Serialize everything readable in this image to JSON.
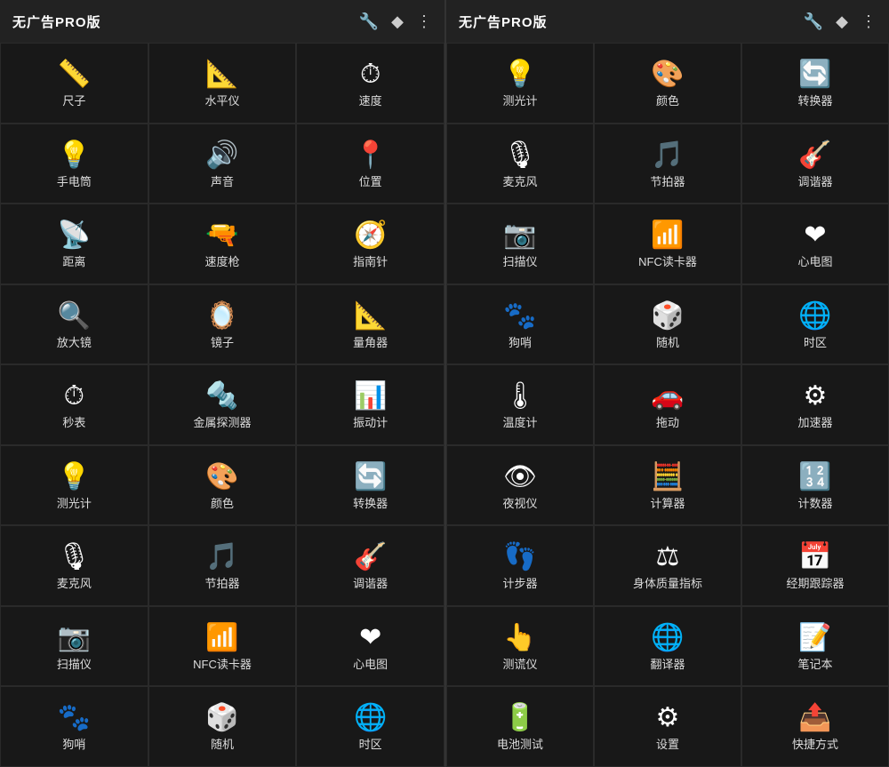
{
  "panels": [
    {
      "id": "left",
      "title": "无广告PRO版",
      "icons": {
        "wrench": "🔧",
        "diamond": "♦",
        "more": "⋮"
      },
      "cells": [
        {
          "icon": "📏",
          "label": "尺子"
        },
        {
          "icon": "📐",
          "label": "水平仪"
        },
        {
          "icon": "⏱",
          "label": "速度"
        },
        {
          "icon": "💡",
          "label": "手电筒"
        },
        {
          "icon": "🔊",
          "label": "声音"
        },
        {
          "icon": "📍",
          "label": "位置"
        },
        {
          "icon": "📡",
          "label": "距离"
        },
        {
          "icon": "🔫",
          "label": "速度枪"
        },
        {
          "icon": "🧭",
          "label": "指南针"
        },
        {
          "icon": "🔍",
          "label": "放大镜"
        },
        {
          "icon": "🪞",
          "label": "镜子"
        },
        {
          "icon": "📐",
          "label": "量角器"
        },
        {
          "icon": "⏱",
          "label": "秒表"
        },
        {
          "icon": "🔩",
          "label": "金属探测器"
        },
        {
          "icon": "📊",
          "label": "振动计"
        },
        {
          "icon": "💡",
          "label": "测光计"
        },
        {
          "icon": "🎨",
          "label": "颜色"
        },
        {
          "icon": "🔄",
          "label": "转换器"
        },
        {
          "icon": "🎙",
          "label": "麦克风"
        },
        {
          "icon": "🎵",
          "label": "节拍器"
        },
        {
          "icon": "🎸",
          "label": "调谐器"
        },
        {
          "icon": "📷",
          "label": "扫描仪"
        },
        {
          "icon": "📶",
          "label": "NFC读卡器"
        },
        {
          "icon": "❤",
          "label": "心电图"
        },
        {
          "icon": "🐾",
          "label": "狗哨"
        },
        {
          "icon": "🎲",
          "label": "随机"
        },
        {
          "icon": "🌐",
          "label": "时区"
        }
      ]
    },
    {
      "id": "right",
      "title": "无广告PRO版",
      "icons": {
        "wrench": "🔧",
        "diamond": "♦",
        "more": "⋮"
      },
      "cells": [
        {
          "icon": "💡",
          "label": "测光计"
        },
        {
          "icon": "🎨",
          "label": "颜色"
        },
        {
          "icon": "🔄",
          "label": "转换器"
        },
        {
          "icon": "🎙",
          "label": "麦克风"
        },
        {
          "icon": "🎵",
          "label": "节拍器"
        },
        {
          "icon": "🎸",
          "label": "调谐器"
        },
        {
          "icon": "📷",
          "label": "扫描仪"
        },
        {
          "icon": "📶",
          "label": "NFC读卡器"
        },
        {
          "icon": "❤",
          "label": "心电图"
        },
        {
          "icon": "🐾",
          "label": "狗哨"
        },
        {
          "icon": "🎲",
          "label": "随机"
        },
        {
          "icon": "🌐",
          "label": "时区"
        },
        {
          "icon": "🌡",
          "label": "温度计"
        },
        {
          "icon": "🚗",
          "label": "拖动"
        },
        {
          "icon": "⚙",
          "label": "加速器"
        },
        {
          "icon": "👁",
          "label": "夜视仪"
        },
        {
          "icon": "🧮",
          "label": "计算器"
        },
        {
          "icon": "🔢",
          "label": "计数器"
        },
        {
          "icon": "👣",
          "label": "计步器"
        },
        {
          "icon": "⚖",
          "label": "身体质量指标"
        },
        {
          "icon": "📅",
          "label": "经期跟踪器"
        },
        {
          "icon": "👆",
          "label": "测谎仪"
        },
        {
          "icon": "🌐",
          "label": "翻译器"
        },
        {
          "icon": "📝",
          "label": "笔记本"
        },
        {
          "icon": "🔋",
          "label": "电池测试"
        },
        {
          "icon": "⚙",
          "label": "设置"
        },
        {
          "icon": "📤",
          "label": "快捷方式"
        }
      ]
    }
  ]
}
